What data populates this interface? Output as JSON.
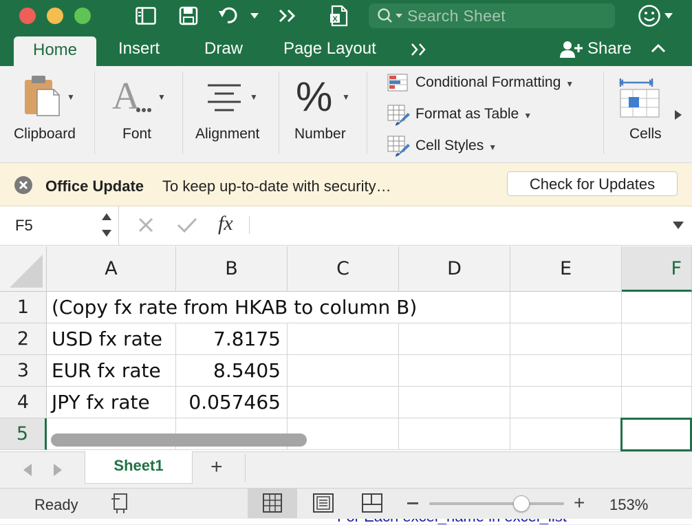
{
  "titlebar": {
    "search_placeholder": "Search Sheet",
    "accent": "#1f7145"
  },
  "tabs": {
    "home": "Home",
    "insert": "Insert",
    "draw": "Draw",
    "page_layout": "Page Layout",
    "share": "Share"
  },
  "ribbon": {
    "clipboard": "Clipboard",
    "font": "Font",
    "alignment": "Alignment",
    "number": "Number",
    "conditional_formatting": "Conditional Formatting",
    "format_as_table": "Format as Table",
    "cell_styles": "Cell Styles",
    "cells": "Cells"
  },
  "update_bar": {
    "title": "Office Update",
    "message": "To keep up-to-date with security…",
    "button": "Check for Updates"
  },
  "formula_bar": {
    "name_box": "F5",
    "formula": ""
  },
  "grid": {
    "columns": [
      "A",
      "B",
      "C",
      "D",
      "E",
      "F"
    ],
    "rows": [
      "1",
      "2",
      "3",
      "4",
      "5"
    ],
    "cells": {
      "A1": "(Copy fx rate from HKAB to column B)",
      "A2": "USD fx rate",
      "B2": "7.8175",
      "A3": "EUR fx rate",
      "B3": "8.5405",
      "A4": "JPY fx rate",
      "B4": "0.057465"
    },
    "selected_cell": "F5"
  },
  "sheets": {
    "active": "Sheet1",
    "add": "+"
  },
  "status": {
    "ready": "Ready",
    "zoom": "153%",
    "zoom_level": 0.68
  },
  "background_code": {
    "text": "For Each excel_name in excel_list"
  }
}
